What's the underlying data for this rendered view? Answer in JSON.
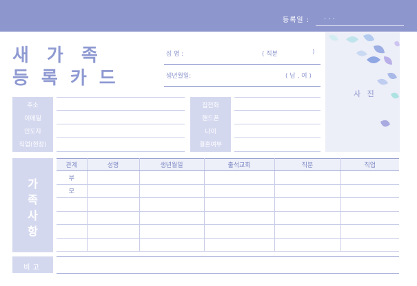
{
  "header": {
    "reg_date_label": "등록일 :",
    "reg_date_value": ".        .        ."
  },
  "title": {
    "line1": "새가족",
    "line2": "등록카드"
  },
  "top_fields": {
    "name_label": "성     명 :",
    "position_label": "( 직분",
    "position_close": ")",
    "birth_label": "생년월일:",
    "gender_label": "( 남 , 여 )"
  },
  "photo": {
    "label": "사 진"
  },
  "info_left": {
    "labels": [
      "주소",
      "이메일",
      "인도자",
      "직업(현장)"
    ]
  },
  "info_right": {
    "labels": [
      "집전화",
      "핸드폰",
      "나이",
      "결혼여부"
    ]
  },
  "family": {
    "side_label": [
      "가",
      "족",
      "사",
      "항"
    ],
    "columns": [
      "관계",
      "성명",
      "생년월일",
      "출석교회",
      "직분",
      "직업"
    ],
    "rows": [
      [
        "부",
        "",
        "",
        "",
        "",
        ""
      ],
      [
        "모",
        "",
        "",
        "",
        "",
        ""
      ],
      [
        "",
        "",
        "",
        "",
        "",
        ""
      ],
      [
        "",
        "",
        "",
        "",
        "",
        ""
      ],
      [
        "",
        "",
        "",
        "",
        "",
        ""
      ],
      [
        "",
        "",
        "",
        "",
        "",
        ""
      ]
    ]
  },
  "remark": {
    "label": "비고"
  },
  "colors": {
    "accent": "#8e97cd",
    "label_bg": "#d4d8ef",
    "photo_bg": "#eceef8"
  }
}
